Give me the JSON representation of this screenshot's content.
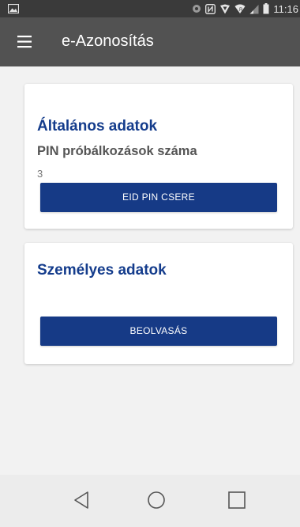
{
  "status_bar": {
    "time": "11:16",
    "left_icon": "image-notification-icon",
    "right_icons": [
      "circle-status-icon",
      "nfc-icon",
      "vpn-shield-icon",
      "wifi-icon",
      "signal-icon",
      "battery-icon"
    ]
  },
  "app_bar": {
    "title": "e-Azonosítás",
    "menu_icon": "hamburger-menu-icon"
  },
  "cards": {
    "general": {
      "title": "Általános adatok",
      "pin_attempts_label": "PIN próbálkozások száma",
      "pin_attempts_value": "3",
      "button_label": "EID PIN CSERE"
    },
    "personal": {
      "title": "Személyes adatok",
      "button_label": "BEOLVASÁS"
    }
  },
  "nav_bar": {
    "back_icon": "back-triangle-icon",
    "home_icon": "home-circle-icon",
    "recent_icon": "recent-apps-square-icon"
  },
  "colors": {
    "status_bar": "#3a3a3a",
    "app_bar": "#525252",
    "card_title": "#143c8c",
    "button": "#163a86",
    "background": "#f2f2f2",
    "nav_bar": "#ececec"
  }
}
